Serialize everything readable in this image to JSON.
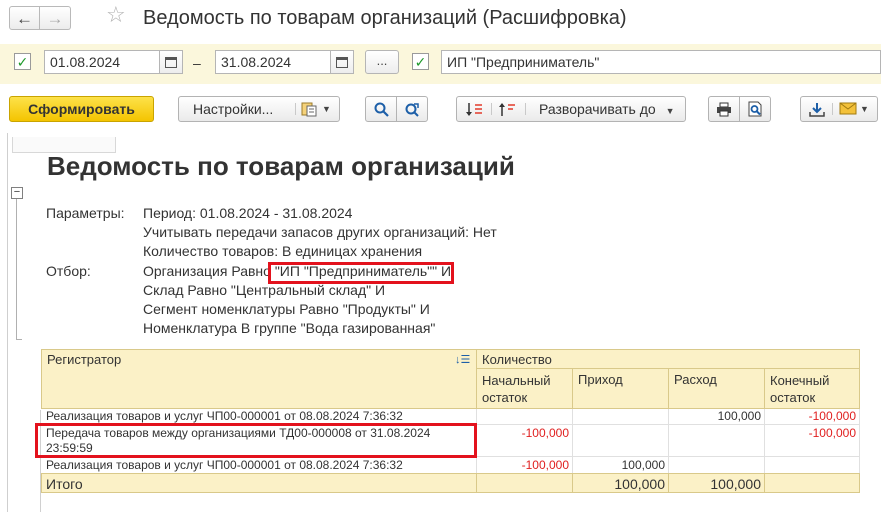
{
  "window": {
    "title": "Ведомость по товарам организаций (Расшифровка)",
    "back_icon": "←",
    "forward_icon": "→",
    "star_icon": "☆"
  },
  "filters": {
    "date_from": "01.08.2024",
    "date_to": "31.08.2024",
    "dash": "–",
    "period_button": "...",
    "organization": "ИП \"Предприниматель\"",
    "check_mark": "✓"
  },
  "toolbar": {
    "generate": "Сформировать",
    "settings": "Настройки...",
    "expand": "Разворачивать до"
  },
  "report": {
    "title": "Ведомость по товарам организаций",
    "params_label": "Параметры:",
    "params": [
      "Период: 01.08.2024 - 31.08.2024",
      "Учитывать передачи запасов других организаций: Нет",
      "Количество товаров: В единицах хранения"
    ],
    "filter_label": "Отбор:",
    "filters": [
      "Организация Равно \"ИП \"Предприниматель\"\" И",
      "Склад Равно \"Центральный склад\" И",
      "Сегмент номенклатуры Равно \"Продукты\" И",
      "Номенклатура В группе \"Вода газированная\""
    ]
  },
  "table": {
    "col_registrar": "Регистратор",
    "sort_icon": "↓☰",
    "col_quantity": "Количество",
    "col_start_1": "Начальный",
    "col_start_2": "остаток",
    "col_in": "Приход",
    "col_out": "Расход",
    "col_end_1": "Конечный",
    "col_end_2": "остаток",
    "rows": [
      {
        "registrar": "Реализация товаров и услуг ЧП00-000001 от 08.08.2024 7:36:32",
        "start": "",
        "in": "",
        "out": "100,000",
        "end": "-100,000"
      },
      {
        "registrar_1": "Передача товаров между организациями ТД00-000008 от 31.08.2024",
        "registrar_2": "23:59:59",
        "start": "-100,000",
        "in": "",
        "out": "",
        "end": "-100,000"
      },
      {
        "registrar": "Реализация товаров и услуг ЧП00-000001 от 08.08.2024 7:36:32",
        "start": "-100,000",
        "in": "100,000",
        "out": "",
        "end": ""
      }
    ],
    "total": {
      "label": "Итого",
      "start": "",
      "in": "100,000",
      "out": "100,000",
      "end": ""
    }
  },
  "colors": {
    "accent_yellow": "#f4c400",
    "header_bg": "#fbf1c7",
    "negative": "#e02020",
    "highlight": "#e3121d",
    "check_green": "#1e9a2a"
  }
}
